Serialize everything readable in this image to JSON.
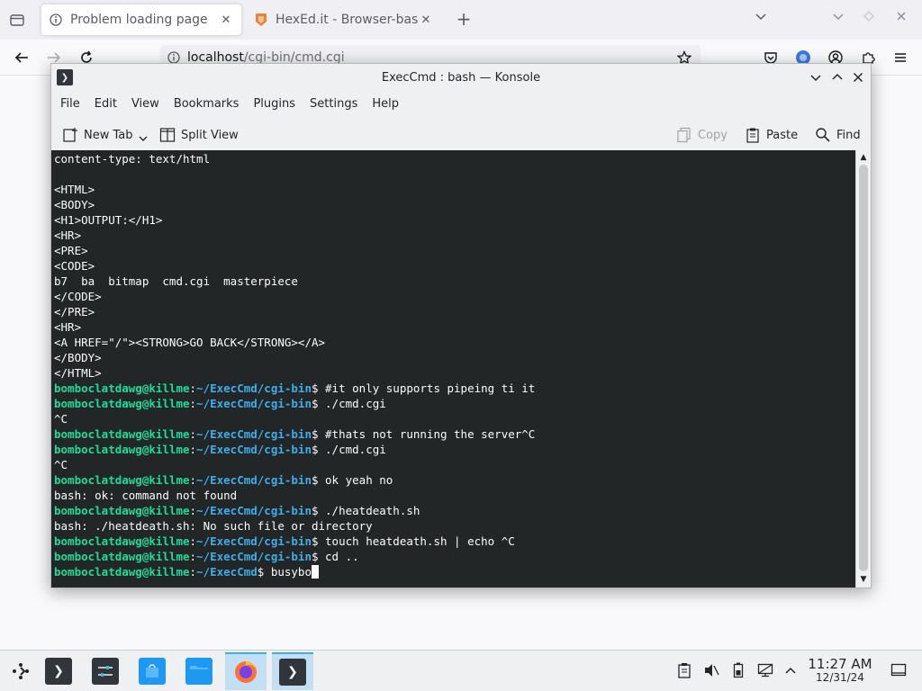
{
  "browser": {
    "tabs": [
      {
        "label": "Problem loading page",
        "icon": "info-icon",
        "selected": true
      },
      {
        "label": "HexEd.it - Browser-based",
        "icon": "hexed-icon",
        "selected": false
      }
    ],
    "url_host": "localhost",
    "url_path": "/cgi-bin/cmd.cgi"
  },
  "konsole": {
    "title": "ExecCmd : bash — Konsole",
    "menu": [
      "File",
      "Edit",
      "View",
      "Bookmarks",
      "Plugins",
      "Settings",
      "Help"
    ],
    "toolbar": {
      "new_tab": "New Tab",
      "split_view": "Split View",
      "copy": "Copy",
      "paste": "Paste",
      "find": "Find"
    },
    "terminal": {
      "lines": [
        {
          "text": "content-type: text/html"
        },
        {
          "text": ""
        },
        {
          "text": "<HTML>"
        },
        {
          "text": "<BODY>"
        },
        {
          "text": "<H1>OUTPUT:</H1>"
        },
        {
          "text": "<HR>"
        },
        {
          "text": "<PRE>"
        },
        {
          "text": "<CODE>"
        },
        {
          "text": "b7  ba  bitmap  cmd.cgi  masterpiece"
        },
        {
          "text": "</CODE>"
        },
        {
          "text": "</PRE>"
        },
        {
          "text": "<HR>"
        },
        {
          "text": "<A HREF=\"/\"><STRONG>GO BACK</STRONG></A>"
        },
        {
          "text": "</BODY>"
        },
        {
          "text": "</HTML>"
        },
        {
          "user": "bomboclatdawg@killme",
          "path": "~/ExecCmd/cgi-bin",
          "cmd": "$ #it only supports pipeing ti it"
        },
        {
          "user": "bomboclatdawg@killme",
          "path": "~/ExecCmd/cgi-bin",
          "cmd": "$ ./cmd.cgi"
        },
        {
          "text": "^C"
        },
        {
          "user": "bomboclatdawg@killme",
          "path": "~/ExecCmd/cgi-bin",
          "cmd": "$ #thats not running the server^C"
        },
        {
          "user": "bomboclatdawg@killme",
          "path": "~/ExecCmd/cgi-bin",
          "cmd": "$ ./cmd.cgi"
        },
        {
          "text": "^C"
        },
        {
          "user": "bomboclatdawg@killme",
          "path": "~/ExecCmd/cgi-bin",
          "cmd": "$ ok yeah no"
        },
        {
          "text": "bash: ok: command not found"
        },
        {
          "user": "bomboclatdawg@killme",
          "path": "~/ExecCmd/cgi-bin",
          "cmd": "$ ./heatdeath.sh"
        },
        {
          "text": "bash: ./heatdeath.sh: No such file or directory"
        },
        {
          "user": "bomboclatdawg@killme",
          "path": "~/ExecCmd/cgi-bin",
          "cmd": "$ touch heatdeath.sh | echo ^C"
        },
        {
          "user": "bomboclatdawg@killme",
          "path": "~/ExecCmd/cgi-bin",
          "cmd": "$ cd .."
        },
        {
          "user": "bomboclatdawg@killme",
          "path": "~/ExecCmd",
          "cmd": "$ busybo",
          "cursor": true
        }
      ]
    }
  },
  "taskbar": {
    "clock_time": "11:27 AM",
    "clock_date": "12/31/24"
  },
  "colors": {
    "terminal_bg": "#232627",
    "prompt_user": "#1cdc9a",
    "prompt_path": "#3daee9",
    "accent": "#3daee9"
  }
}
